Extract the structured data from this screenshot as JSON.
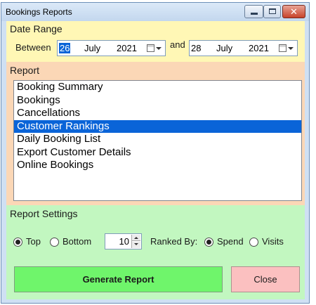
{
  "window": {
    "title": "Bookings Reports",
    "close_glyph": "✕"
  },
  "date_range": {
    "group_label": "Date Range",
    "between_label": "Between",
    "and_label": "and",
    "from": {
      "day": "26",
      "month": "July",
      "year": "2021"
    },
    "to": {
      "day": "28",
      "month": "July",
      "year": "2021"
    }
  },
  "report": {
    "group_label": "Report",
    "items": [
      "Booking Summary",
      "Bookings",
      "Cancellations",
      "Customer Rankings",
      "Daily Booking List",
      "Export Customer Details",
      "Online Bookings"
    ],
    "selected": "Customer Rankings"
  },
  "settings": {
    "group_label": "Report Settings",
    "top_label": "Top",
    "bottom_label": "Bottom",
    "top_selected": true,
    "count_value": "10",
    "ranked_by_label": "Ranked By:",
    "spend_label": "Spend",
    "visits_label": "Visits",
    "rank_selected": "Spend"
  },
  "buttons": {
    "generate_label": "Generate Report",
    "close_label": "Close"
  },
  "colors": {
    "date_group_bg": "#fff7b5",
    "report_group_bg": "#fbd7b6",
    "settings_group_bg": "#c2f7c0",
    "generate_button_bg": "#6ff56b",
    "close_button_bg": "#fbc0c0",
    "selection": "#0a64d8"
  }
}
